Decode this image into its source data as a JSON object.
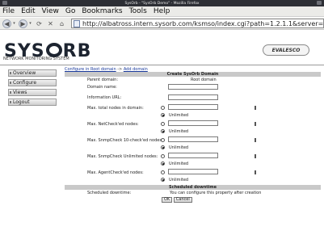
{
  "window": {
    "title": "SysOrb - \"SysOrb Demo\" - Mozilla Firefox"
  },
  "menu": [
    "File",
    "Edit",
    "View",
    "Go",
    "Bookmarks",
    "Tools",
    "Help"
  ],
  "url": "http://albatross.intern.sysorb.com/ksmso/index.cgi?path=1.2.1.1&server=alba",
  "brand": {
    "logo_pre": "SYS",
    "logo_post": "RB",
    "tagline": "NETWORK MONITORING SYSTEM",
    "partner": "EVALESCO"
  },
  "nav": [
    "Overview",
    "Configure",
    "Views",
    "Logout"
  ],
  "breadcrumb": {
    "first": "Configure in Root domain",
    "sep": "->",
    "last": "Add domain"
  },
  "section1": "Create SysOrb Domain",
  "form": {
    "parent_label": "Parent domain:",
    "parent_value": "Root domain",
    "domain_name_label": "Domain name:",
    "info_url_label": "Information URL:",
    "unlimited": "Unlimited",
    "limits": [
      "Max. total nodes in domain:",
      "Max. NetCheck'ed nodes:",
      "Max. SnmpCheck 10-check'ed nodes:",
      "Max. SnmpCheck Unlimited nodes:",
      "Max. AgentCheck'ed nodes:"
    ]
  },
  "section2": "Scheduled downtime",
  "downtime": {
    "label": "Scheduled downtime:",
    "note": "You can configure this property after creation"
  },
  "buttons": {
    "ok": "OK",
    "cancel": "Cancel"
  }
}
